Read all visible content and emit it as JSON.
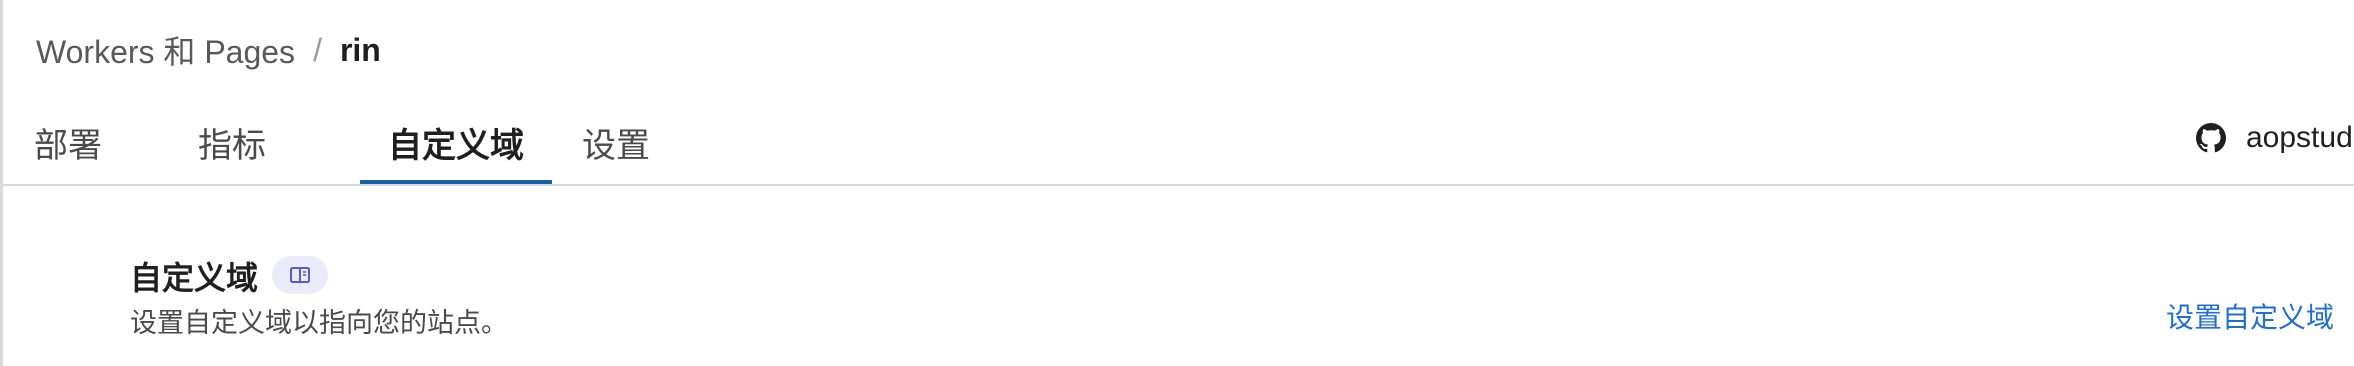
{
  "breadcrumb": {
    "parent": "Workers 和 Pages",
    "separator": "/",
    "current": "rin"
  },
  "tabs": [
    {
      "label": "部署"
    },
    {
      "label": "指标"
    },
    {
      "label": "自定义域",
      "active": true
    },
    {
      "label": "设置"
    }
  ],
  "repo": {
    "icon": "github-icon",
    "name": "aopstud"
  },
  "section": {
    "title": "自定义域",
    "docs_icon": "book-icon",
    "description": "设置自定义域以指向您的站点。",
    "action_label": "设置自定义域"
  },
  "colors": {
    "accent": "#1a5fb4",
    "link": "#1f6fdb",
    "badge_bg": "#ebebf9",
    "badge_icon": "#5a5ac8",
    "divider": "#d9d9d9"
  }
}
